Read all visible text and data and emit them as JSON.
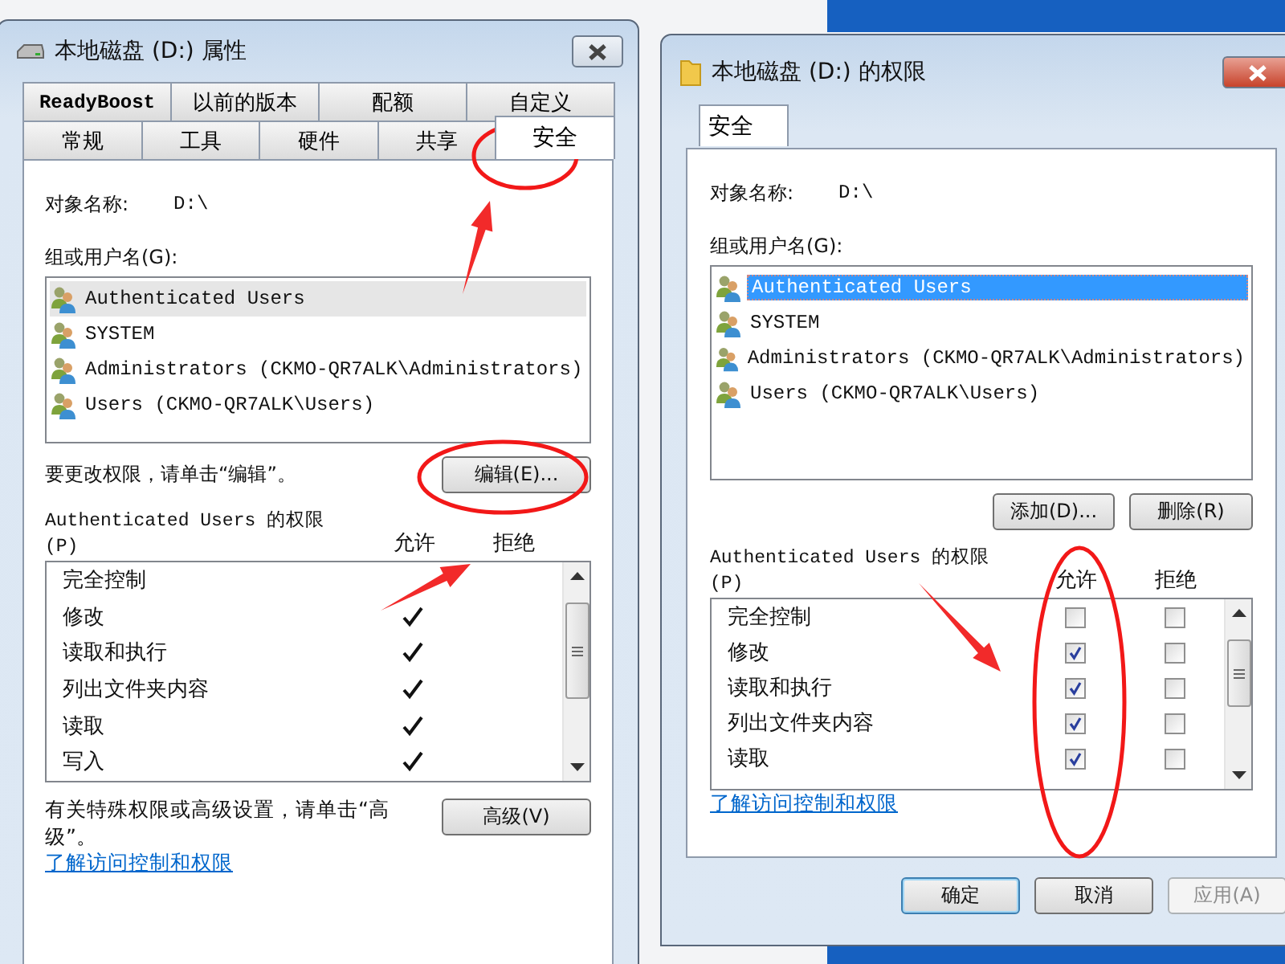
{
  "properties_dialog": {
    "title": "本地磁盘 (D:) 属性",
    "tab_rows": [
      [
        {
          "label": "ReadyBoost",
          "selected": false
        },
        {
          "label": "以前的版本",
          "selected": false
        },
        {
          "label": "配额",
          "selected": false
        },
        {
          "label": "自定义",
          "selected": false
        }
      ],
      [
        {
          "label": "常规",
          "selected": false
        },
        {
          "label": "工具",
          "selected": false
        },
        {
          "label": "硬件",
          "selected": false
        },
        {
          "label": "共享",
          "selected": false
        },
        {
          "label": "安全",
          "selected": true
        }
      ]
    ],
    "object_label": "对象名称:",
    "object_value": "D:\\",
    "users_label": "组或用户名(G):",
    "users": [
      {
        "name": "Authenticated Users",
        "selected": true
      },
      {
        "name": "SYSTEM",
        "selected": false
      },
      {
        "name": "Administrators (CKMO-QR7ALK\\Administrators)",
        "selected": false
      },
      {
        "name": "Users (CKMO-QR7ALK\\Users)",
        "selected": false
      }
    ],
    "edit_hint": "要更改权限，请单击“编辑”。",
    "edit_button": "编辑(E)...",
    "perm_title": "Authenticated Users 的权限",
    "perm_key": "(P)",
    "allow_header": "允许",
    "deny_header": "拒绝",
    "permissions": [
      {
        "name": "完全控制",
        "allow": false
      },
      {
        "name": "修改",
        "allow": true
      },
      {
        "name": "读取和执行",
        "allow": true
      },
      {
        "name": "列出文件夹内容",
        "allow": true
      },
      {
        "name": "读取",
        "allow": true
      },
      {
        "name": "写入",
        "allow": true
      }
    ],
    "advanced_hint": "有关特殊权限或高级设置，请单击“高级”。",
    "advanced_button": "高级(V)",
    "link": "了解访问控制和权限"
  },
  "permissions_dialog": {
    "title": "本地磁盘 (D:) 的权限",
    "tab": {
      "label": "安全",
      "selected": true
    },
    "object_label": "对象名称:",
    "object_value": "D:\\",
    "users_label": "组或用户名(G):",
    "users": [
      {
        "name": "Authenticated Users",
        "selected": true
      },
      {
        "name": "SYSTEM",
        "selected": false
      },
      {
        "name": "Administrators (CKMO-QR7ALK\\Administrators)",
        "selected": false
      },
      {
        "name": "Users (CKMO-QR7ALK\\Users)",
        "selected": false
      }
    ],
    "add_button": "添加(D)...",
    "remove_button": "删除(R)",
    "perm_title": "Authenticated Users 的权限",
    "perm_key": "(P)",
    "allow_header": "允许",
    "deny_header": "拒绝",
    "permissions": [
      {
        "name": "完全控制",
        "allow": false,
        "deny": false
      },
      {
        "name": "修改",
        "allow": true,
        "deny": false
      },
      {
        "name": "读取和执行",
        "allow": true,
        "deny": false
      },
      {
        "name": "列出文件夹内容",
        "allow": true,
        "deny": false
      },
      {
        "name": "读取",
        "allow": true,
        "deny": false
      }
    ],
    "link": "了解访问控制和权限",
    "buttons": [
      {
        "label": "确定",
        "default": true,
        "disabled": false
      },
      {
        "label": "取消",
        "default": false,
        "disabled": false
      },
      {
        "label": "应用(A)",
        "default": false,
        "disabled": true
      }
    ]
  }
}
